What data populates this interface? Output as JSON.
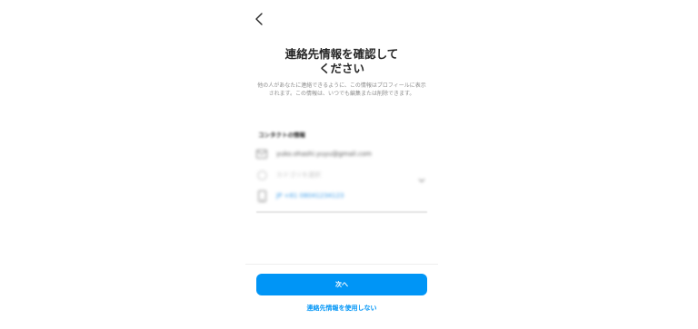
{
  "header": {
    "back_icon": "chevron-left-icon"
  },
  "main": {
    "title": "連絡先情報を確認して\nください",
    "description": "他の人があなたに連絡できるように、この情報はプロフィールに表示されます。この情報は、いつでも編集または削除できます。"
  },
  "contact": {
    "section_label": "コンタクトの情報",
    "email": {
      "icon": "envelope-icon",
      "value": "yuko.ohashi.yuyu@gmail.com"
    },
    "country": {
      "icon": "globe-icon",
      "value": "カテゴリを選択"
    },
    "phone": {
      "icon": "phone-icon",
      "value": "JP +81 08041234123"
    }
  },
  "footer": {
    "next_label": "次へ",
    "skip_label": "連絡先情報を使用しない"
  },
  "colors": {
    "accent": "#0095f6",
    "text": "#262626",
    "muted": "#8e8e8e"
  }
}
